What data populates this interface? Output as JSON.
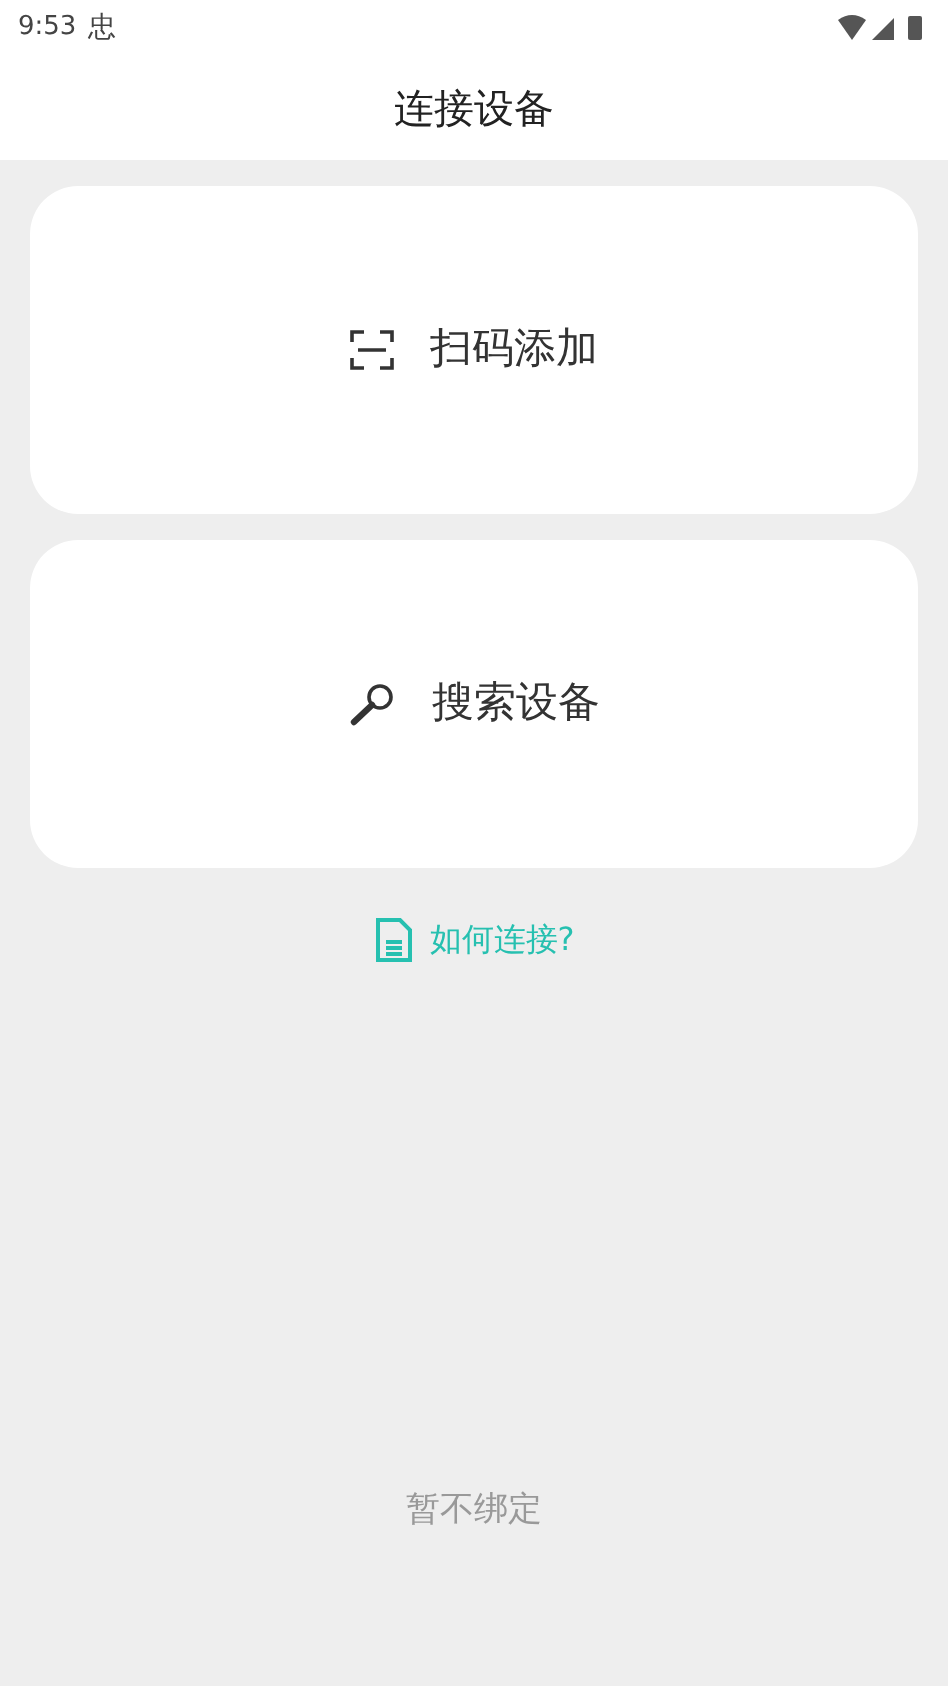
{
  "status_bar": {
    "time": "9:53",
    "notification": "忠"
  },
  "header": {
    "title": "连接设备"
  },
  "options": [
    {
      "kind": "scan",
      "label": "扫码添加"
    },
    {
      "kind": "search",
      "label": "搜索设备"
    }
  ],
  "help_link": {
    "label": "如何连接?"
  },
  "skip_button": {
    "label": "暂不绑定"
  }
}
